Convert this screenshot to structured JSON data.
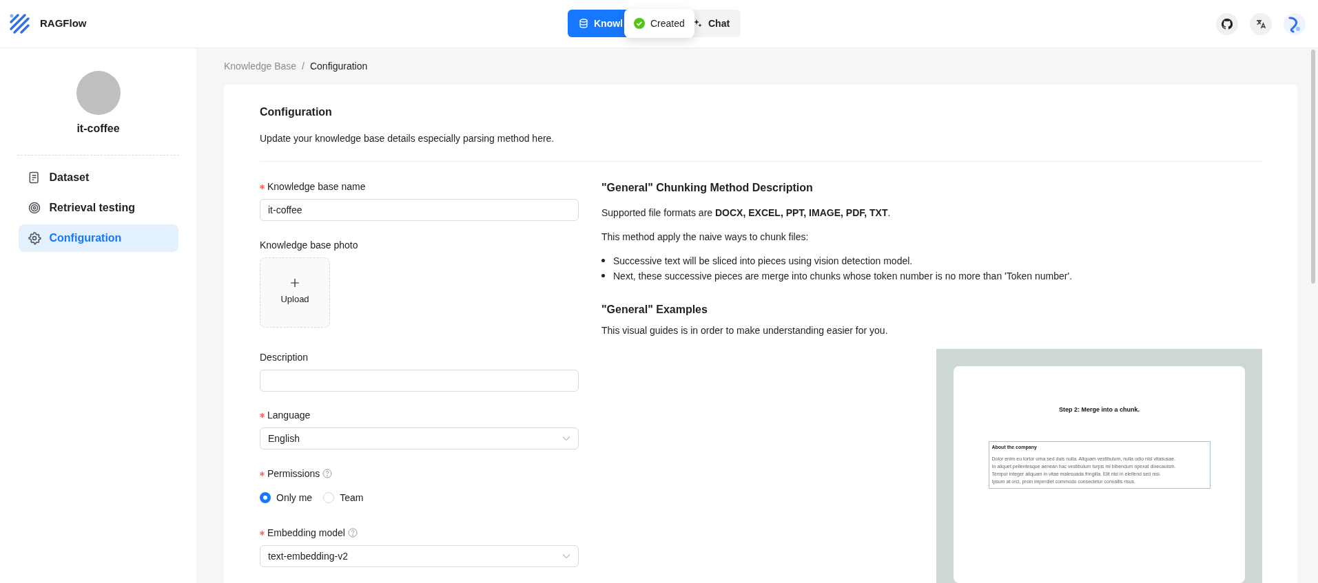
{
  "header": {
    "logo_text": "RAGFlow",
    "nav": [
      {
        "label": "Knowl",
        "selected": true
      },
      {
        "label": "Chat",
        "selected": false
      }
    ],
    "toast": {
      "text": "Created"
    }
  },
  "sidebar": {
    "kb_name": "it-coffee",
    "items": [
      {
        "label": "Dataset",
        "selected": false
      },
      {
        "label": "Retrieval testing",
        "selected": false
      },
      {
        "label": "Configuration",
        "selected": true
      }
    ]
  },
  "breadcrumb": {
    "items": [
      "Knowledge Base",
      "Configuration"
    ],
    "separator": "/"
  },
  "card": {
    "title": "Configuration",
    "subtitle": "Update your knowledge base details especially parsing method here."
  },
  "form": [
    {
      "kind": "text",
      "label": "Knowledge base name",
      "required": true,
      "help": false,
      "value": "it-coffee"
    },
    {
      "kind": "upload",
      "label": "Knowledge base photo",
      "required": false,
      "help": false,
      "button": "Upload"
    },
    {
      "kind": "text",
      "label": "Description",
      "required": false,
      "help": false
    },
    {
      "kind": "select",
      "label": "Language",
      "required": true,
      "help": false,
      "value": "English"
    },
    {
      "kind": "radio",
      "label": "Permissions",
      "required": true,
      "help": true,
      "options": [
        {
          "label": "Only me",
          "selected": true
        },
        {
          "label": "Team",
          "selected": false
        }
      ]
    },
    {
      "kind": "select",
      "label": "Embedding model",
      "required": true,
      "help": true,
      "value": "text-embedding-v2"
    }
  ],
  "method": {
    "heading": "\"General\" Chunking Method Description",
    "formats": "Supported file formats are **DOCX, EXCEL, PPT, IMAGE, PDF, TXT**.",
    "intro": "This method apply the naive ways to chunk files:",
    "bullets": [
      "Successive text will be sliced into pieces using vision detection model.",
      "Next, these successive pieces are merge into chunks whose token number is no more than 'Token number'."
    ],
    "examples_heading": "\"General\" Examples",
    "examples_text": "This visual guides is in order to make understanding easier for you.",
    "example": {
      "step_title": "Step 2: Merge into a chunk.",
      "chunk_title": "About the company",
      "chunk_lines": [
        "Dolor enim eu tortor urna sed duis nulla. Aliquam vestibulum, nulla odio nisl vitasusae.",
        "In aliquet pellentesque aenean hac vestibulum turpis mi bibendum npexat dixecauism.",
        "Tempor integer aliquam in vitae malesuada fringilla. Elit nisi in eleifend sed nisi.",
        "Ipsum at orci, proin imperdiet commodo consectetur convallis risus."
      ]
    }
  }
}
